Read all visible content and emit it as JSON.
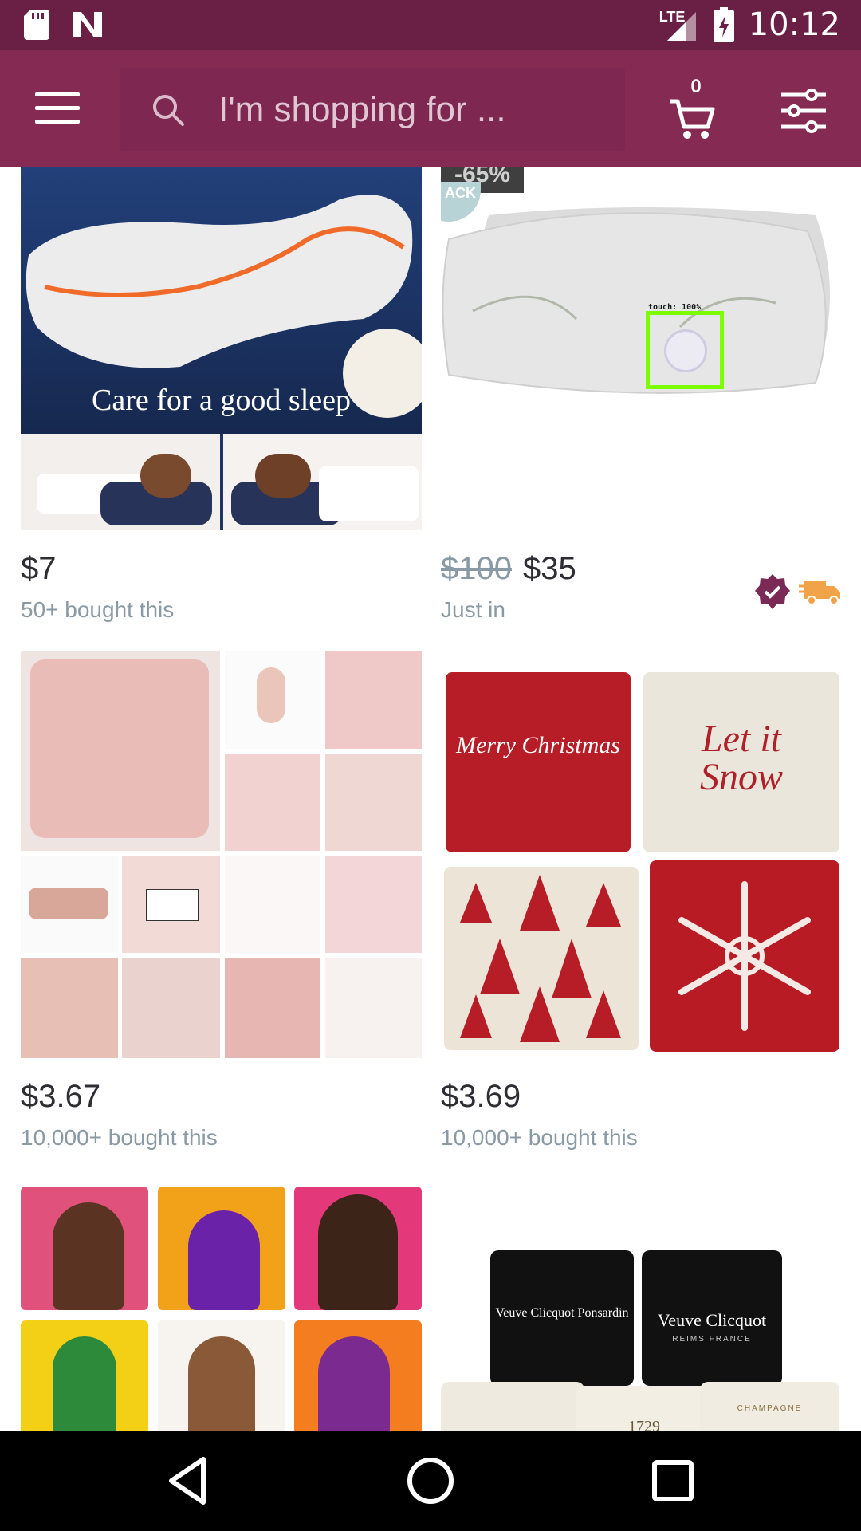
{
  "status_bar": {
    "time": "10:12",
    "network": "LTE"
  },
  "app_bar": {
    "search_placeholder": "I'm shopping for ...",
    "cart_count": "0"
  },
  "products": [
    {
      "image_caption": "Care for a good sleep",
      "price": "$7",
      "original_price": "",
      "subtitle": "50+ bought this"
    },
    {
      "discount": "-65%",
      "tag": "ACK",
      "touch_label": "touch: 100%",
      "price": "$35",
      "original_price": "$100",
      "subtitle": "Just in"
    },
    {
      "price": "$3.67",
      "original_price": "",
      "subtitle": "10,000+ bought this"
    },
    {
      "price": "$3.69",
      "original_price": "",
      "subtitle": "10,000+ bought this",
      "pillow_texts": [
        "Merry Christmas",
        "Let it Snow"
      ]
    },
    {},
    {
      "pillow_texts": [
        "Veuve Clicquot Ponsardin",
        "Veuve Clicquot",
        "REIMS FRANCE",
        "1729",
        "CHAMPAGNE"
      ]
    }
  ],
  "colors": {
    "status_bar": "#6a1f45",
    "app_bar": "#852a53",
    "verified_badge": "#7b2a56",
    "shipping_icon": "#f0a347"
  },
  "icons": [
    "menu-icon",
    "search-icon",
    "cart-icon",
    "filter-icon",
    "verified-icon",
    "shipping-truck-icon",
    "back-icon",
    "home-icon",
    "recents-icon"
  ]
}
